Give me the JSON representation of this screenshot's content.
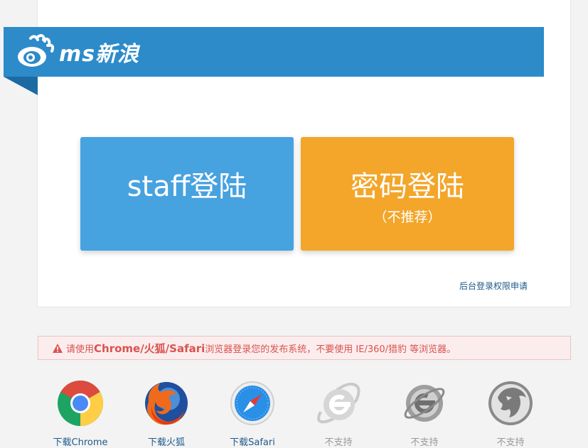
{
  "header": {
    "brand": "ms新浪"
  },
  "login": {
    "staff_label": "staff登陆",
    "password_label": "密码登陆",
    "password_note": "（不推荐）",
    "apply_link": "后台登录权限申请"
  },
  "warning": {
    "prefix": "请使用",
    "browsers": "Chrome/火狐/Safari",
    "suffix": "浏览器登录您的发布系统，不要使用 IE/360/猎豹 等浏览器。"
  },
  "browsers": [
    {
      "icon": "chrome-icon",
      "label": "下载Chrome"
    },
    {
      "icon": "firefox-icon",
      "label": "下载火狐"
    },
    {
      "icon": "safari-icon",
      "label": "下载Safari"
    },
    {
      "icon": "ie-icon",
      "label": "不支持"
    },
    {
      "icon": "ie-old-icon",
      "label": "不支持"
    },
    {
      "icon": "cheetah-icon",
      "label": "不支持"
    }
  ],
  "colors": {
    "header_blue": "#2d8bc9",
    "staff_blue": "#47a2e0",
    "password_orange": "#f3a62a",
    "warning_red": "#d9534f"
  }
}
